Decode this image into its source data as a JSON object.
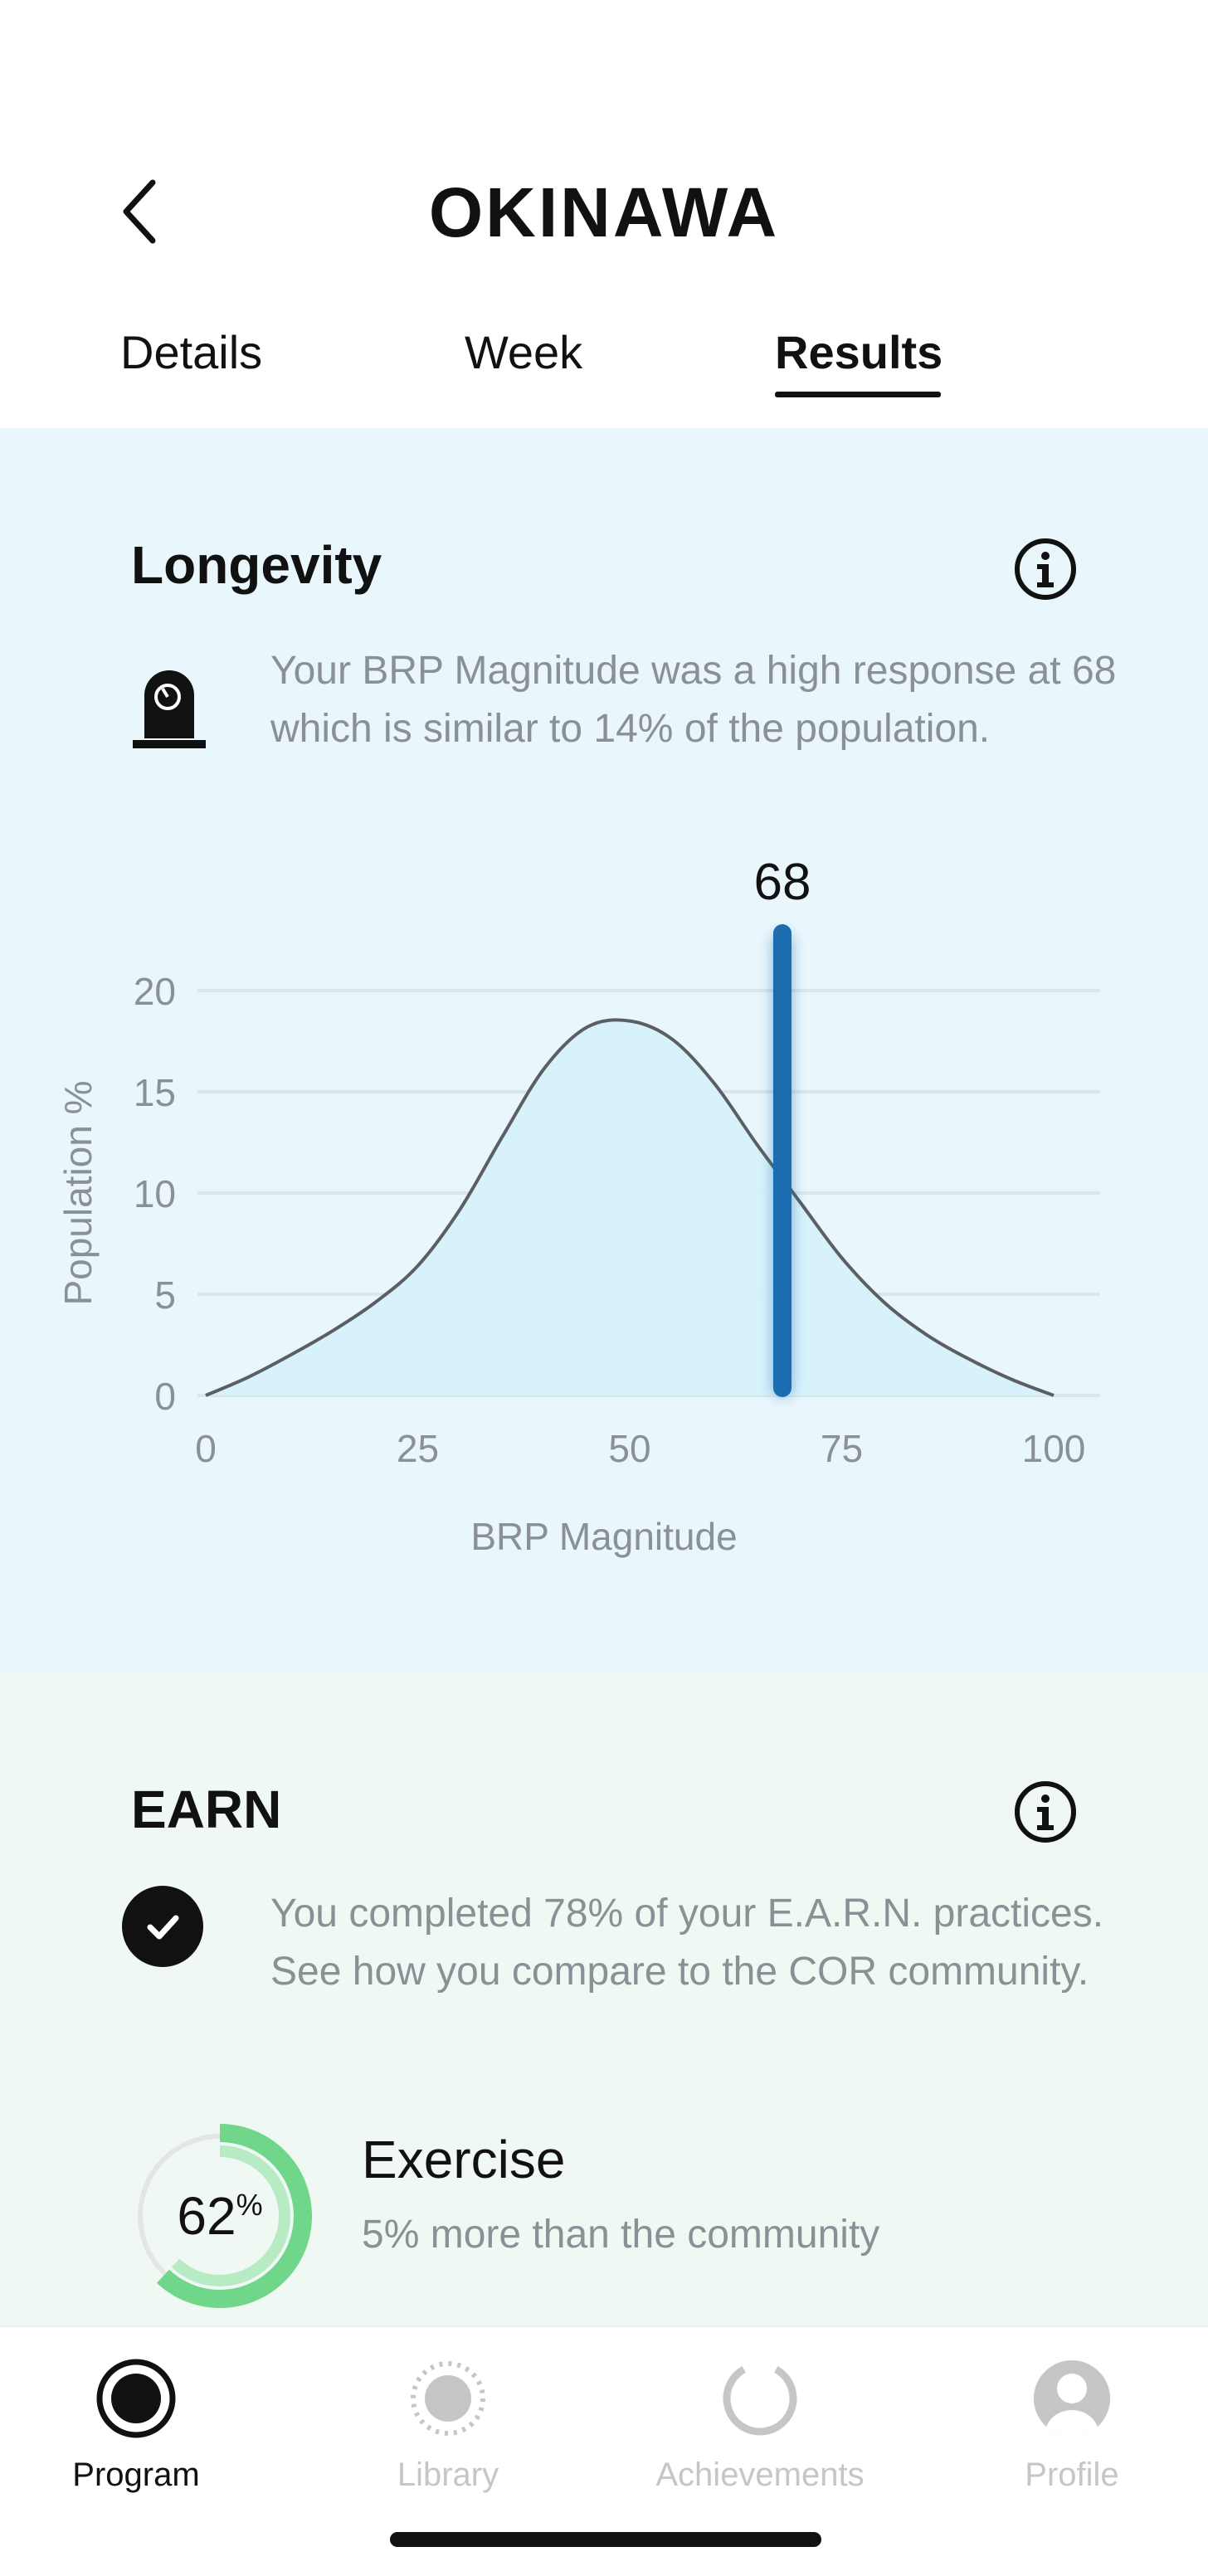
{
  "header": {
    "title": "OKINAWA",
    "tabs": [
      {
        "label": "Details"
      },
      {
        "label": "Week"
      },
      {
        "label": "Results"
      }
    ],
    "active_tab": "Results"
  },
  "longevity": {
    "title": "Longevity",
    "description": "Your BRP Magnitude was a high response at 68 which is similar to 14% of the population.",
    "icon": "brp-device-icon"
  },
  "chart_data": {
    "type": "area",
    "title": "",
    "xlabel": "BRP Magnitude",
    "ylabel": "Population %",
    "xlim": [
      0,
      100
    ],
    "ylim": [
      0,
      20
    ],
    "x_ticks": [
      "0",
      "25",
      "50",
      "75",
      "100"
    ],
    "y_ticks": [
      "0",
      "5",
      "10",
      "15",
      "20"
    ],
    "grid": true,
    "series": [
      {
        "x": [
          0,
          5,
          10,
          15,
          20,
          25,
          30,
          35,
          40,
          45,
          50,
          55,
          60,
          65,
          70,
          75,
          80,
          85,
          90,
          95,
          100
        ],
        "y": [
          0,
          0.9,
          2,
          3.2,
          4.6,
          6.4,
          9.2,
          12.8,
          16.2,
          18.2,
          18.5,
          17.6,
          15.4,
          12.4,
          9.6,
          6.8,
          4.6,
          3,
          1.8,
          0.8,
          0
        ]
      }
    ],
    "marker": {
      "x": 68,
      "label": "68"
    },
    "colors": {
      "fill": "#d6f2fc",
      "line": "#5b5f63",
      "marker": "#1c6cb0",
      "grid": "#d9e6ec",
      "tick": "#8a9095"
    }
  },
  "earn": {
    "title": "EARN",
    "description": "You completed 78% of your E.A.R.N. practices. See how you compare to the COR community.",
    "practice": {
      "value": 62,
      "value_text": "62",
      "unit": "%",
      "name": "Exercise",
      "comparison": "5% more than the community"
    },
    "colors": {
      "ring_outer": "#6fd68a",
      "ring_inner": "#b7ebc4",
      "track": "#e3e6e4"
    }
  },
  "nav": {
    "items": [
      {
        "label": "Program",
        "active": true
      },
      {
        "label": "Library",
        "active": false
      },
      {
        "label": "Achievements",
        "active": false
      },
      {
        "label": "Profile",
        "active": false
      }
    ],
    "colors": {
      "active": "#111111",
      "inactive": "#c4c6c8"
    }
  }
}
